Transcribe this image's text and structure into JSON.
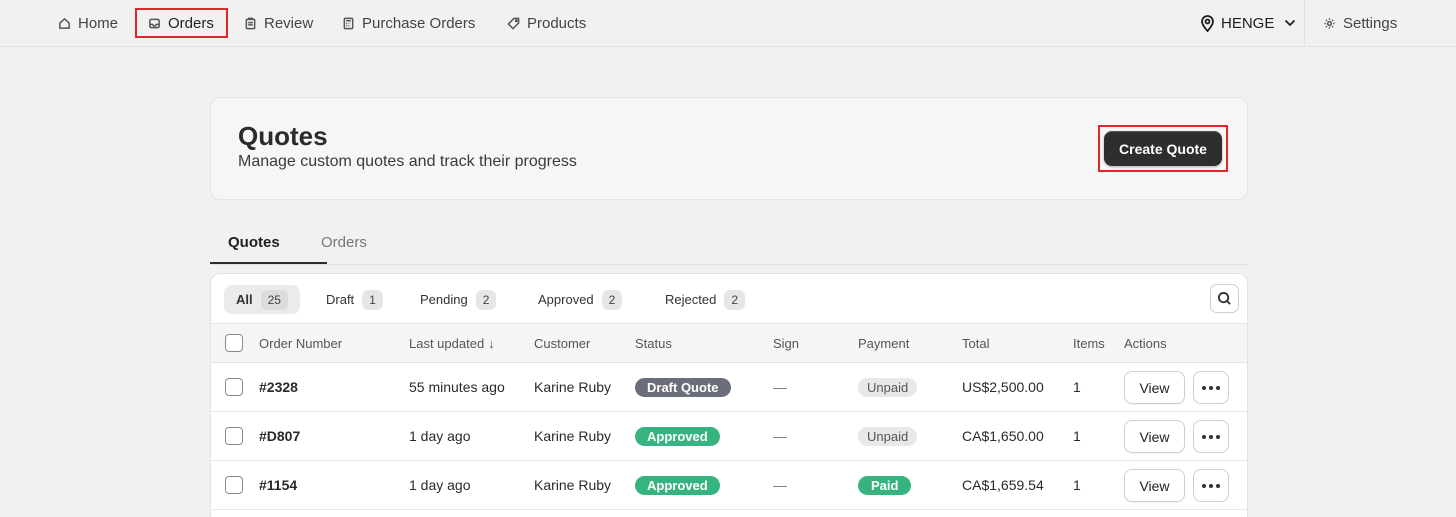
{
  "nav": {
    "items": [
      {
        "label": "Home",
        "icon": "home-icon"
      },
      {
        "label": "Orders",
        "icon": "inbox-icon"
      },
      {
        "label": "Review",
        "icon": "clipboard-icon"
      },
      {
        "label": "Purchase Orders",
        "icon": "calculator-icon"
      },
      {
        "label": "Products",
        "icon": "tag-icon"
      }
    ],
    "location": "HENGE",
    "settings": "Settings"
  },
  "header": {
    "title": "Quotes",
    "subtitle": "Manage custom quotes and track their progress",
    "create_label": "Create Quote"
  },
  "tabs": [
    {
      "label": "Quotes"
    },
    {
      "label": "Orders"
    }
  ],
  "filters": [
    {
      "label": "All",
      "count": "25"
    },
    {
      "label": "Draft",
      "count": "1"
    },
    {
      "label": "Pending",
      "count": "2"
    },
    {
      "label": "Approved",
      "count": "2"
    },
    {
      "label": "Rejected",
      "count": "2"
    }
  ],
  "columns": {
    "order_number": "Order Number",
    "last_updated": "Last updated",
    "sort_arrow": "↓",
    "customer": "Customer",
    "status": "Status",
    "sign": "Sign",
    "payment": "Payment",
    "total": "Total",
    "items": "Items",
    "actions": "Actions"
  },
  "rows": [
    {
      "order": "#2328",
      "updated": "55 minutes ago",
      "customer": "Karine Ruby",
      "status": "Draft Quote",
      "sign": "—",
      "payment": "Unpaid",
      "total": "US$2,500.00",
      "items": "1",
      "view": "View"
    },
    {
      "order": "#D807",
      "updated": "1 day ago",
      "customer": "Karine Ruby",
      "status": "Approved",
      "sign": "—",
      "payment": "Unpaid",
      "total": "CA$1,650.00",
      "items": "1",
      "view": "View"
    },
    {
      "order": "#1154",
      "updated": "1 day ago",
      "customer": "Karine Ruby",
      "status": "Approved",
      "sign": "—",
      "payment": "Paid",
      "total": "CA$1,659.54",
      "items": "1",
      "view": "View"
    }
  ],
  "colors": {
    "highlight": "#e0262b",
    "primary_button": "#2e2e2e",
    "approved": "#36b37e",
    "draft": "#6b6e78"
  }
}
